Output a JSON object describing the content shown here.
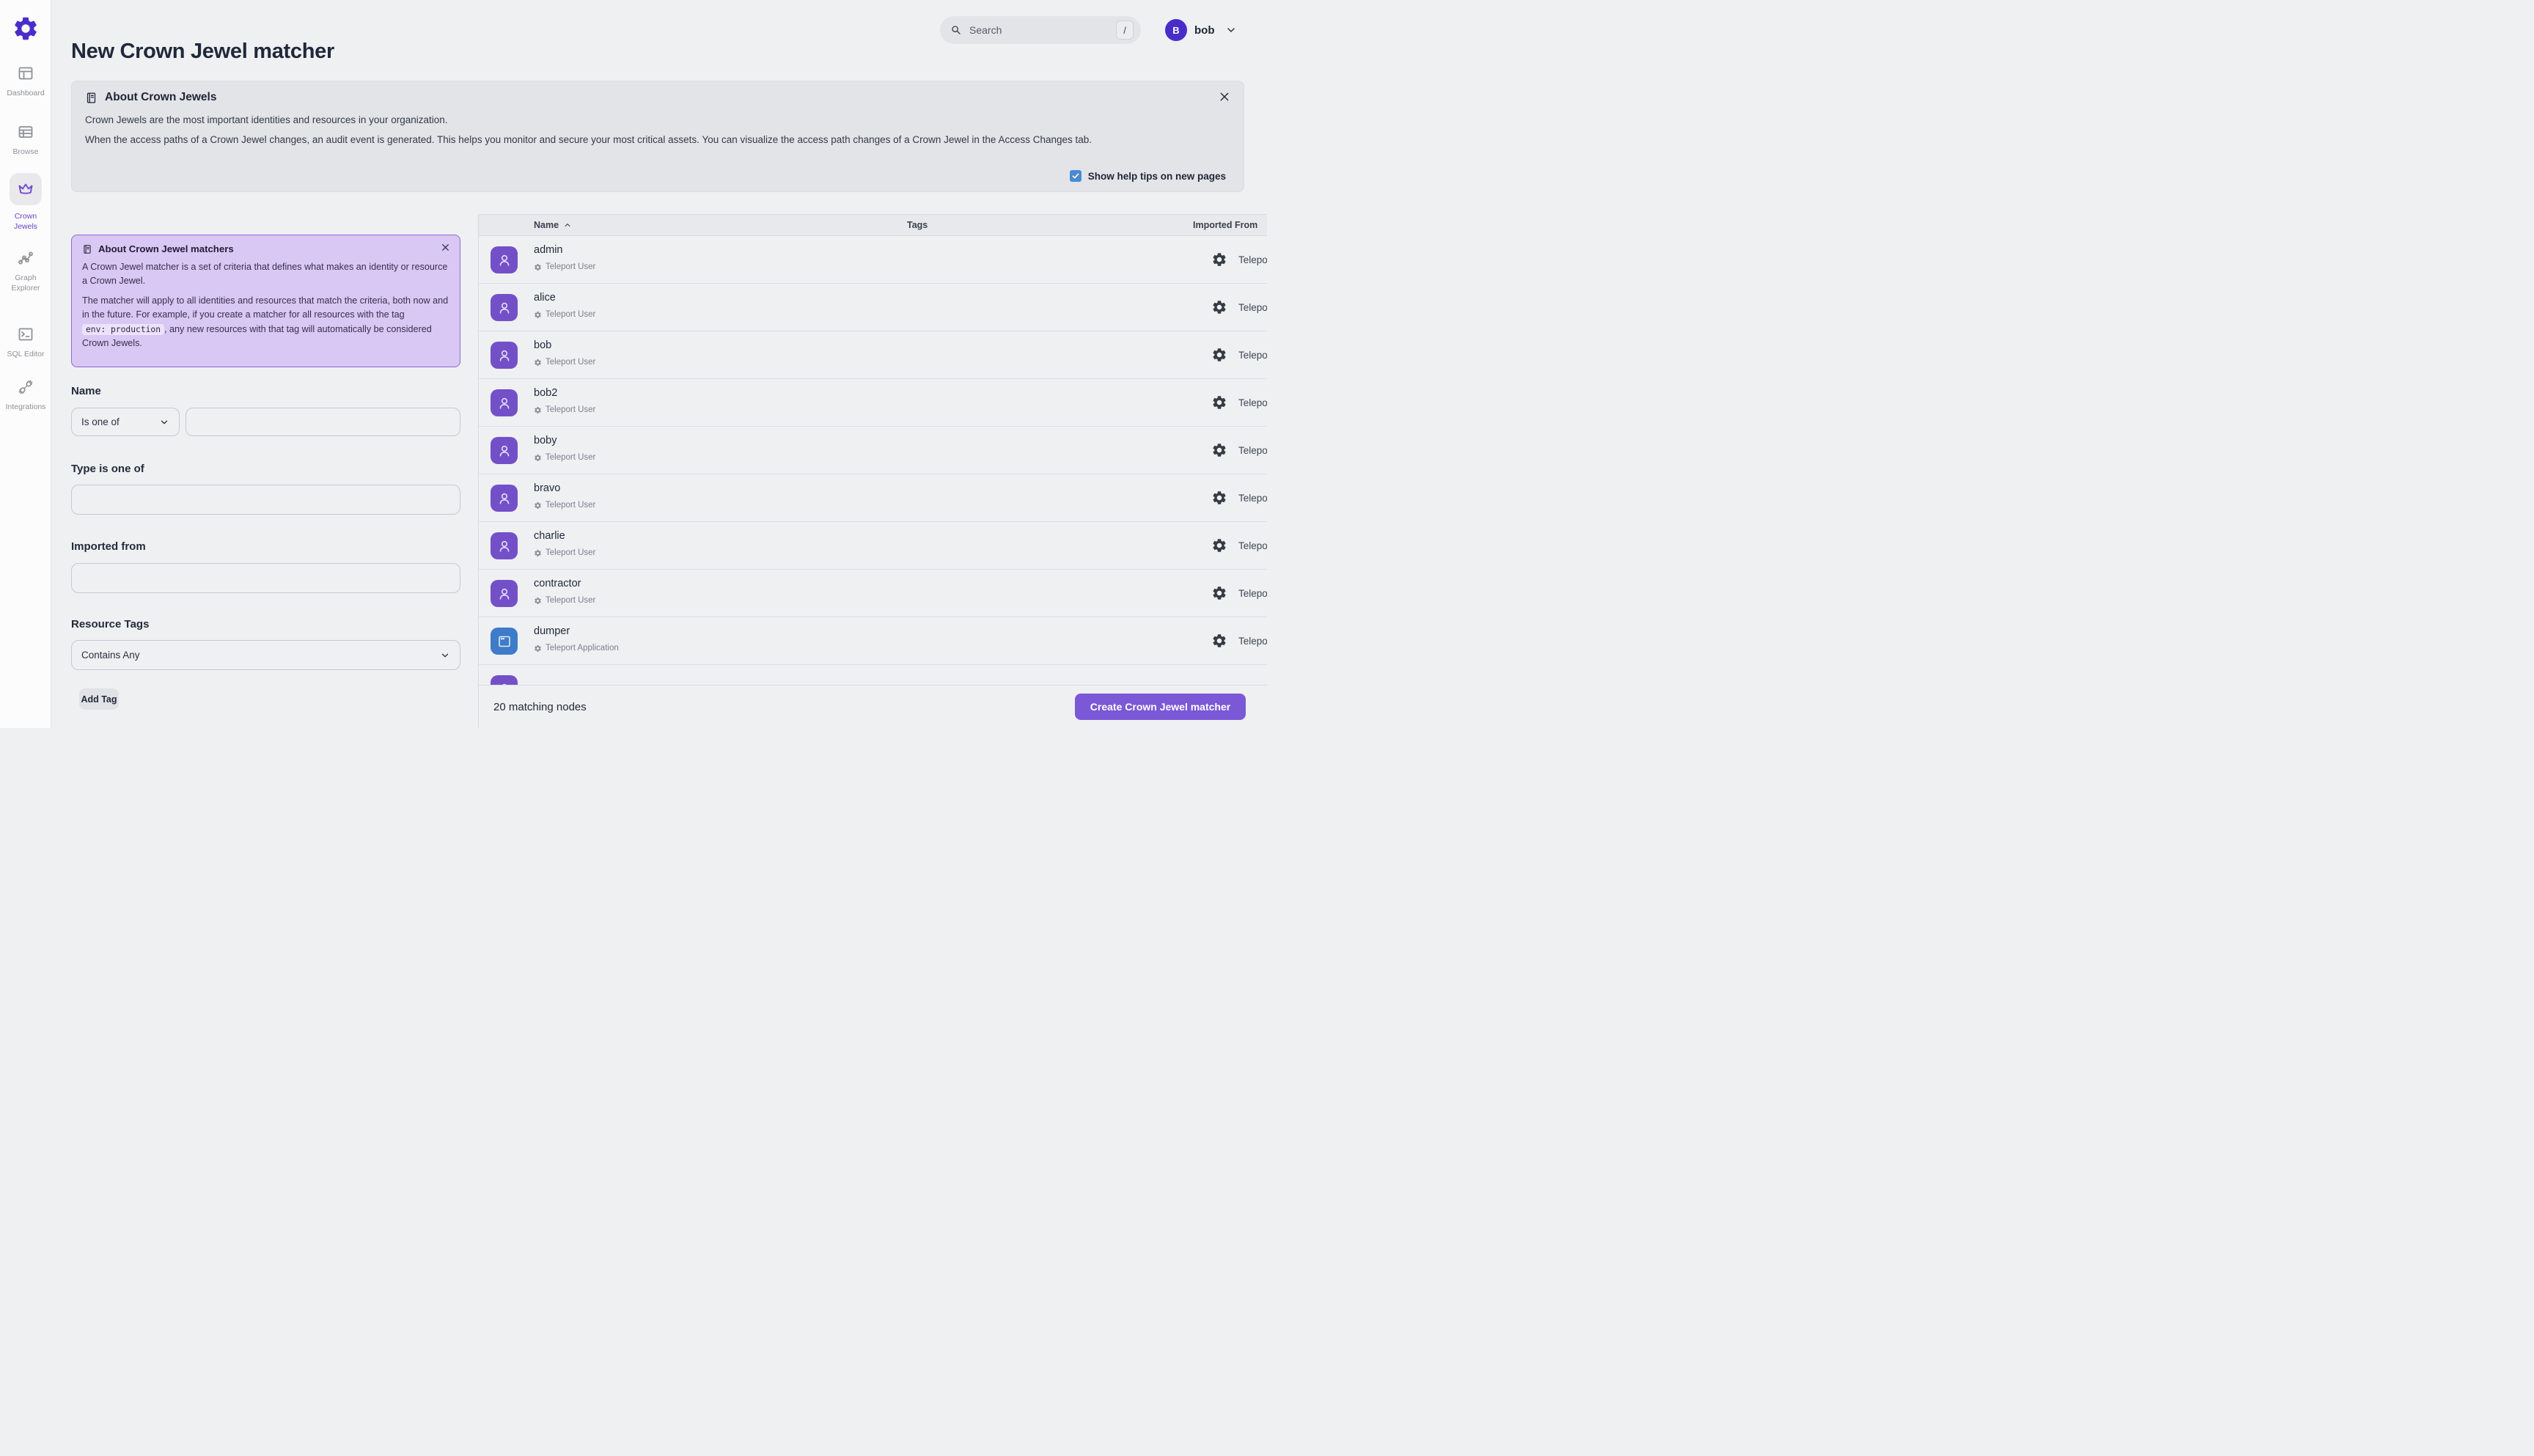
{
  "sidebar": {
    "items": [
      {
        "label": "Dashboard",
        "icon": "dashboard-icon",
        "active": false
      },
      {
        "label": "Browse",
        "icon": "browse-icon",
        "active": false
      },
      {
        "label": "Crown Jewels",
        "icon": "crown-icon",
        "active": true
      },
      {
        "label": "Graph Explorer",
        "icon": "graph-icon",
        "active": false
      },
      {
        "label": "SQL Editor",
        "icon": "terminal-icon",
        "active": false
      },
      {
        "label": "Integrations",
        "icon": "plug-icon",
        "active": false
      }
    ],
    "labels": {
      "dashboard": "Dashboard",
      "browse": "Browse",
      "crown1": "Crown",
      "crown2": "Jewels",
      "graph1": "Graph",
      "graph2": "Explorer",
      "sql": "SQL Editor",
      "integrations": "Integrations"
    }
  },
  "header": {
    "search_placeholder": "Search",
    "search_shortcut": "/",
    "user_initial": "B",
    "user_name": "bob"
  },
  "page": {
    "title": "New Crown Jewel matcher"
  },
  "about_banner": {
    "title": "About Crown Jewels",
    "line1": "Crown Jewels are the most important identities and resources in your organization.",
    "line2": "When the access paths of a Crown Jewel changes, an audit event is generated. This helps you monitor and secure your most critical assets. You can visualize the access path changes of a Crown Jewel in the Access Changes tab.",
    "checkbox_label": "Show help tips on new pages",
    "checkbox_checked": true
  },
  "matcher_card": {
    "title": "About Crown Jewel matchers",
    "para1": "A Crown Jewel matcher is a set of criteria that defines what makes an identity or resource a Crown Jewel.",
    "para2_before": "The matcher will apply to all identities and resources that match the criteria, both now and in the future. For example, if you create a matcher for all resources with the tag ",
    "para2_code": "env: production",
    "para2_after": ", any new resources with that tag will automatically be considered Crown Jewels."
  },
  "form": {
    "name_label": "Name",
    "name_operator": "Is one of",
    "name_value": "",
    "type_label": "Type is one of",
    "type_value": "",
    "imported_label": "Imported from",
    "imported_value": "",
    "tags_label": "Resource Tags",
    "tags_operator": "Contains Any",
    "add_tag_label": "Add Tag"
  },
  "table": {
    "columns": {
      "name": "Name",
      "tags": "Tags",
      "imported": "Imported From"
    },
    "imported_from_value": "Teleport",
    "rows": [
      {
        "name": "admin",
        "type": "Teleport User",
        "kind": "user"
      },
      {
        "name": "alice",
        "type": "Teleport User",
        "kind": "user"
      },
      {
        "name": "bob",
        "type": "Teleport User",
        "kind": "user"
      },
      {
        "name": "bob2",
        "type": "Teleport User",
        "kind": "user"
      },
      {
        "name": "boby",
        "type": "Teleport User",
        "kind": "user"
      },
      {
        "name": "bravo",
        "type": "Teleport User",
        "kind": "user"
      },
      {
        "name": "charlie",
        "type": "Teleport User",
        "kind": "user"
      },
      {
        "name": "contractor",
        "type": "Teleport User",
        "kind": "user"
      },
      {
        "name": "dumper",
        "type": "Teleport Application",
        "kind": "app"
      }
    ]
  },
  "footer": {
    "count_text": "20 matching nodes",
    "create_label": "Create Crown Jewel matcher"
  },
  "colors": {
    "brand_purple": "#4a2dc9",
    "accent_purple": "#7a58d6",
    "row_avatar_purple": "#7450c8",
    "app_avatar_blue": "#3e7bc8",
    "card_bg": "#d9c8f3",
    "card_border": "#9068d8",
    "checkbox_blue": "#4a8ad2",
    "page_bg": "#eef0f2",
    "banner_bg": "#e3e4e8"
  }
}
